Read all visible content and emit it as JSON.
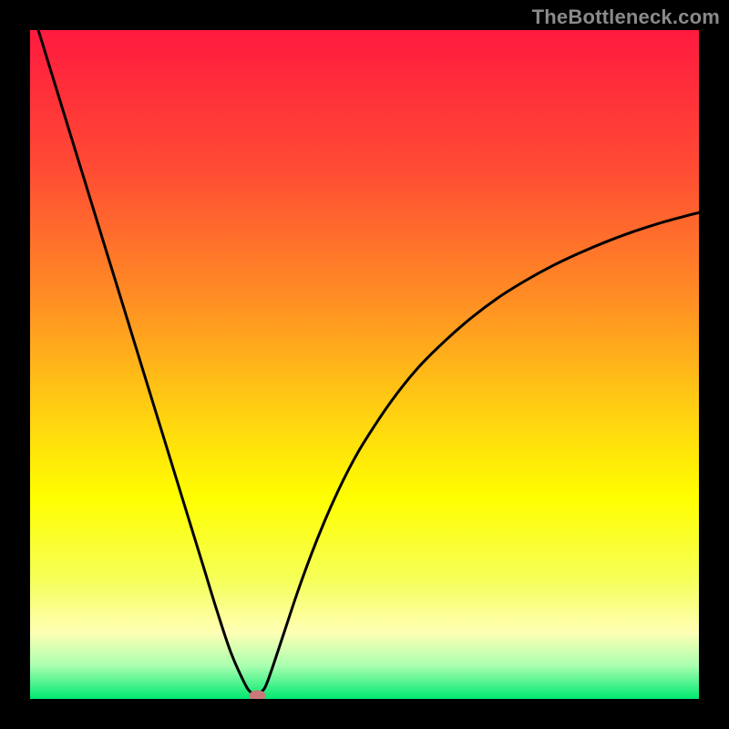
{
  "watermark": {
    "text": "TheBottleneck.com"
  },
  "chart_data": {
    "type": "line",
    "title": "",
    "xlabel": "",
    "ylabel": "",
    "xlim": [
      0,
      100
    ],
    "ylim": [
      0,
      100
    ],
    "x": [
      0,
      2,
      4,
      6,
      8,
      10,
      12,
      14,
      16,
      18,
      20,
      22,
      24,
      26,
      28,
      30,
      32,
      33,
      34,
      35,
      36,
      38,
      40,
      42,
      44,
      46,
      48,
      50,
      54,
      58,
      62,
      66,
      70,
      74,
      78,
      82,
      86,
      90,
      94,
      98,
      100
    ],
    "values": [
      104,
      97.5,
      91,
      84.5,
      78,
      71.5,
      65,
      58.5,
      52,
      45.5,
      39,
      32.5,
      26,
      19.5,
      13,
      7,
      2.5,
      1.0,
      0.9,
      1.5,
      4,
      10,
      16,
      21.5,
      26.5,
      31,
      35,
      38.5,
      44.5,
      49.5,
      53.5,
      57,
      60,
      62.5,
      64.7,
      66.6,
      68.3,
      69.8,
      71.1,
      72.2,
      72.7
    ],
    "background_gradient": {
      "type": "vertical",
      "stops": [
        {
          "pos": 0.0,
          "color": "#ff1a3f"
        },
        {
          "pos": 0.2,
          "color": "#ff4934"
        },
        {
          "pos": 0.4,
          "color": "#ff8d24"
        },
        {
          "pos": 0.55,
          "color": "#ffc814"
        },
        {
          "pos": 0.7,
          "color": "#ffff00"
        },
        {
          "pos": 0.82,
          "color": "#f5ff57"
        },
        {
          "pos": 0.9,
          "color": "#ffffb4"
        },
        {
          "pos": 0.95,
          "color": "#aaffb0"
        },
        {
          "pos": 1.0,
          "color": "#00e871"
        }
      ]
    },
    "marker": {
      "x": 34,
      "y": 0.5,
      "color": "#c77a79"
    }
  }
}
